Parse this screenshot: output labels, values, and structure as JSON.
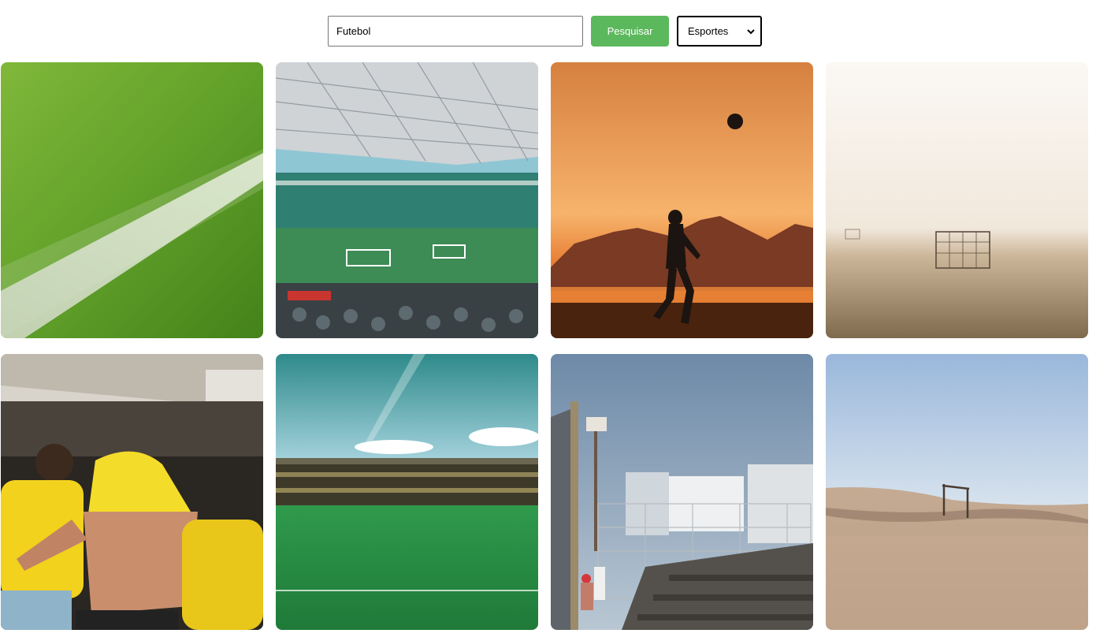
{
  "search": {
    "value": "Futebol",
    "button_label": "Pesquisar"
  },
  "category": {
    "selected": "Esportes"
  },
  "accent_color": "#5cb85c",
  "gallery": {
    "images": [
      {
        "subject": "grass-field-line"
      },
      {
        "subject": "stadium-roof-crowd"
      },
      {
        "subject": "sunset-beach-silhouette"
      },
      {
        "subject": "foggy-goal-field"
      },
      {
        "subject": "fans-brazil-jersey"
      },
      {
        "subject": "green-stadium-pitch"
      },
      {
        "subject": "fenced-stands-street"
      },
      {
        "subject": "desert-goal-dunes"
      }
    ]
  }
}
